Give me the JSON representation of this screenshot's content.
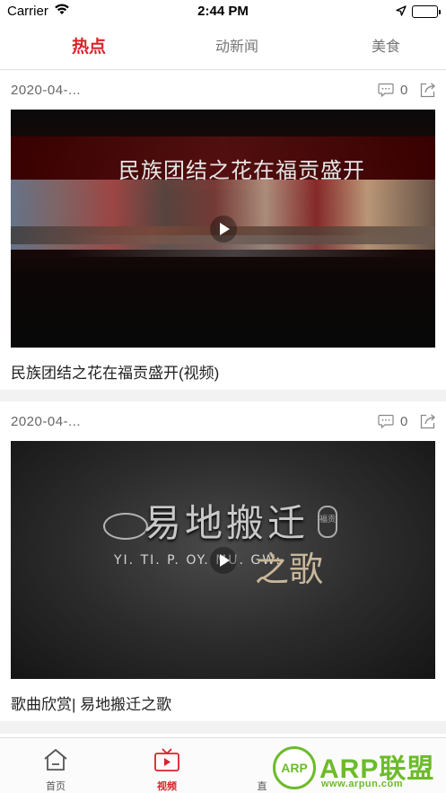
{
  "status_bar": {
    "carrier": "Carrier",
    "time": "2:44 PM",
    "battery_level": 1.0
  },
  "tabs": [
    {
      "label": "热点",
      "active": true
    },
    {
      "label": "动新闻",
      "active": false
    },
    {
      "label": "美食",
      "active": false
    }
  ],
  "feed": {
    "items": [
      {
        "date": "2020-04-...",
        "comment_count": "0",
        "video_headline": "民族团结之花在福贡盛开",
        "title": "民族团结之花在福贡盛开(视频)"
      },
      {
        "date": "2020-04-...",
        "comment_count": "0",
        "video_headline": "易地搬迁",
        "video_subtitle": "YI. TI. P. OY. MU. GW:",
        "video_headline2": "之歌",
        "video_seal": "福贡",
        "title": "歌曲欣赏| 易地搬迁之歌"
      }
    ]
  },
  "tab_bar": {
    "items": [
      {
        "label": "首页",
        "icon": "home-icon",
        "active": false
      },
      {
        "label": "视频",
        "icon": "tv-icon",
        "active": true
      },
      {
        "label": "直",
        "icon": "partial-icon",
        "active": false
      }
    ]
  },
  "watermark": {
    "badge": "ARP",
    "brand": "ARP联盟",
    "url": "www.arpun.com"
  },
  "colors": {
    "accent": "#d8242a",
    "watermark": "#6dbb2a"
  }
}
